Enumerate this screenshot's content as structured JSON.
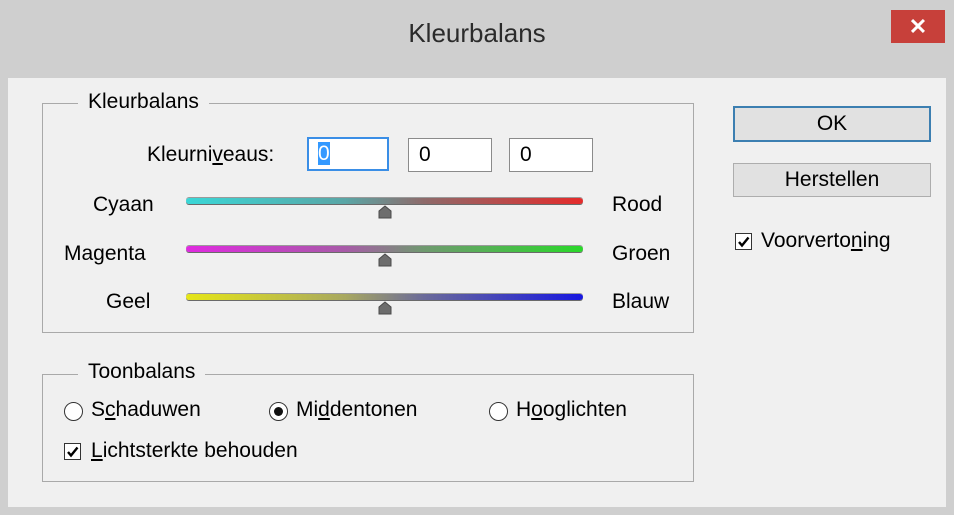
{
  "window": {
    "title": "Kleurbalans",
    "close_symbol": "✕"
  },
  "color_balance": {
    "legend": "Kleurbalans",
    "levels_label_pre": "Kleurni",
    "levels_label_mn": "v",
    "levels_label_post": "eaus:",
    "levels": [
      "0",
      "0",
      "0"
    ],
    "sliders": [
      {
        "left": "Cyaan",
        "right": "Rood",
        "value": 0
      },
      {
        "left": "Magenta",
        "right": "Groen",
        "value": 0
      },
      {
        "left": "Geel",
        "right": "Blauw",
        "value": 0
      }
    ]
  },
  "tone_balance": {
    "legend": "Toonbalans",
    "options": [
      {
        "pre": "S",
        "mn": "c",
        "post": "haduwen",
        "selected": false
      },
      {
        "pre": "Mi",
        "mn": "d",
        "post": "dentonen",
        "selected": true
      },
      {
        "pre": "H",
        "mn": "o",
        "post": "oglichten",
        "selected": false
      }
    ],
    "preserve": {
      "mn": "L",
      "post": "ichtsterkte behouden",
      "checked": true
    }
  },
  "buttons": {
    "ok": "OK",
    "reset": "Herstellen"
  },
  "preview": {
    "pre": "Voorverto",
    "mn": "n",
    "post": "ing",
    "checked": true
  },
  "icons": {
    "close": "close-icon",
    "slider_thumb": "triangle-up-icon",
    "checkmark": "checkmark-icon",
    "radio_dot": "radio-dot-icon"
  },
  "colors": {
    "accent_focus": "#3a8ee6",
    "close_button": "#c7403a",
    "selection": "#3399ff"
  }
}
